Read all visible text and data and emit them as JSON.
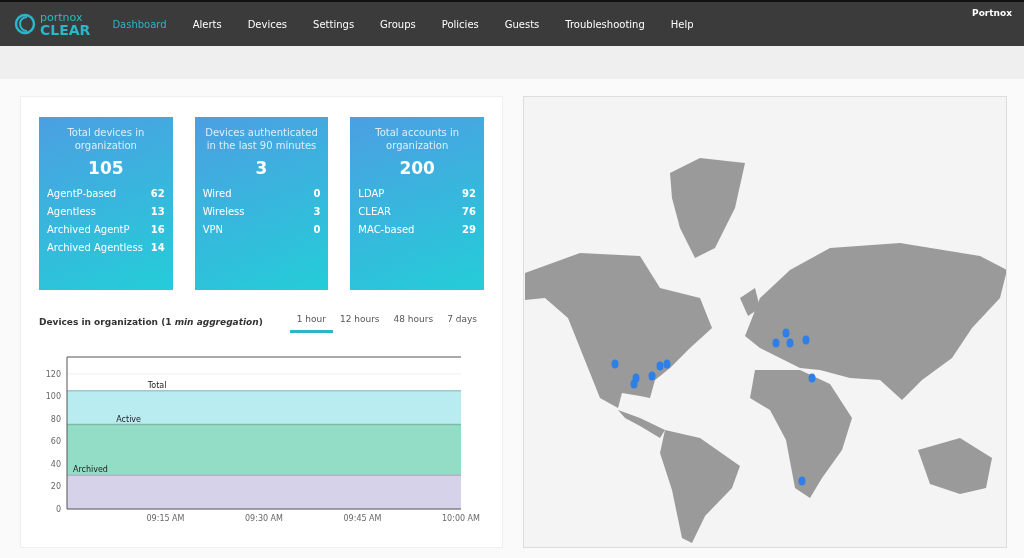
{
  "nav": {
    "logo_top": "portnox",
    "logo_bottom": "CLEAR",
    "items": [
      {
        "label": "Dashboard",
        "selected": true
      },
      {
        "label": "Alerts",
        "selected": false
      },
      {
        "label": "Devices",
        "selected": false
      },
      {
        "label": "Settings",
        "selected": false
      },
      {
        "label": "Groups",
        "selected": false
      },
      {
        "label": "Policies",
        "selected": false
      },
      {
        "label": "Guests",
        "selected": false
      },
      {
        "label": "Troubleshooting",
        "selected": false
      },
      {
        "label": "Help",
        "selected": false
      }
    ],
    "account": "Portnox"
  },
  "cards": [
    {
      "title": "Total devices in organization",
      "total": "105",
      "rows": [
        {
          "label": "AgentP-based",
          "value": "62"
        },
        {
          "label": "Agentless",
          "value": "13"
        },
        {
          "label": "Archived AgentP",
          "value": "16"
        },
        {
          "label": "Archived Agentless",
          "value": "14"
        }
      ]
    },
    {
      "title": "Devices authenticated in the last 90 minutes",
      "total": "3",
      "rows": [
        {
          "label": "Wired",
          "value": "0"
        },
        {
          "label": "Wireless",
          "value": "3"
        },
        {
          "label": "VPN",
          "value": "0"
        }
      ]
    },
    {
      "title": "Total accounts in organization",
      "total": "200",
      "rows": [
        {
          "label": "LDAP",
          "value": "92"
        },
        {
          "label": "CLEAR",
          "value": "76"
        },
        {
          "label": "MAC-based",
          "value": "29"
        }
      ]
    }
  ],
  "devices_chart": {
    "title": "Devices in organization (1 *min aggregation*)",
    "ranges": [
      {
        "label": "1 hour",
        "selected": true
      },
      {
        "label": "12 hours",
        "selected": false
      },
      {
        "label": "48 hours",
        "selected": false
      },
      {
        "label": "7 days",
        "selected": false
      }
    ],
    "chart_data": {
      "type": "area",
      "categories": [
        null,
        "09:15 AM",
        "09:30 AM",
        "09:45 AM",
        "10:00 AM"
      ],
      "ylim": [
        0,
        135
      ],
      "yticks": [
        0,
        20,
        40,
        60,
        80,
        100,
        120
      ],
      "series": [
        {
          "name": "Total",
          "color": "#b9ecf0",
          "values": [
            105,
            105,
            105,
            105,
            105
          ]
        },
        {
          "name": "Active",
          "color": "#93dcc6",
          "values": [
            75,
            75,
            75,
            75,
            75
          ]
        },
        {
          "name": "Archived",
          "color": "#d6d2ea",
          "values": [
            30,
            30,
            30,
            30,
            30
          ]
        }
      ]
    }
  }
}
